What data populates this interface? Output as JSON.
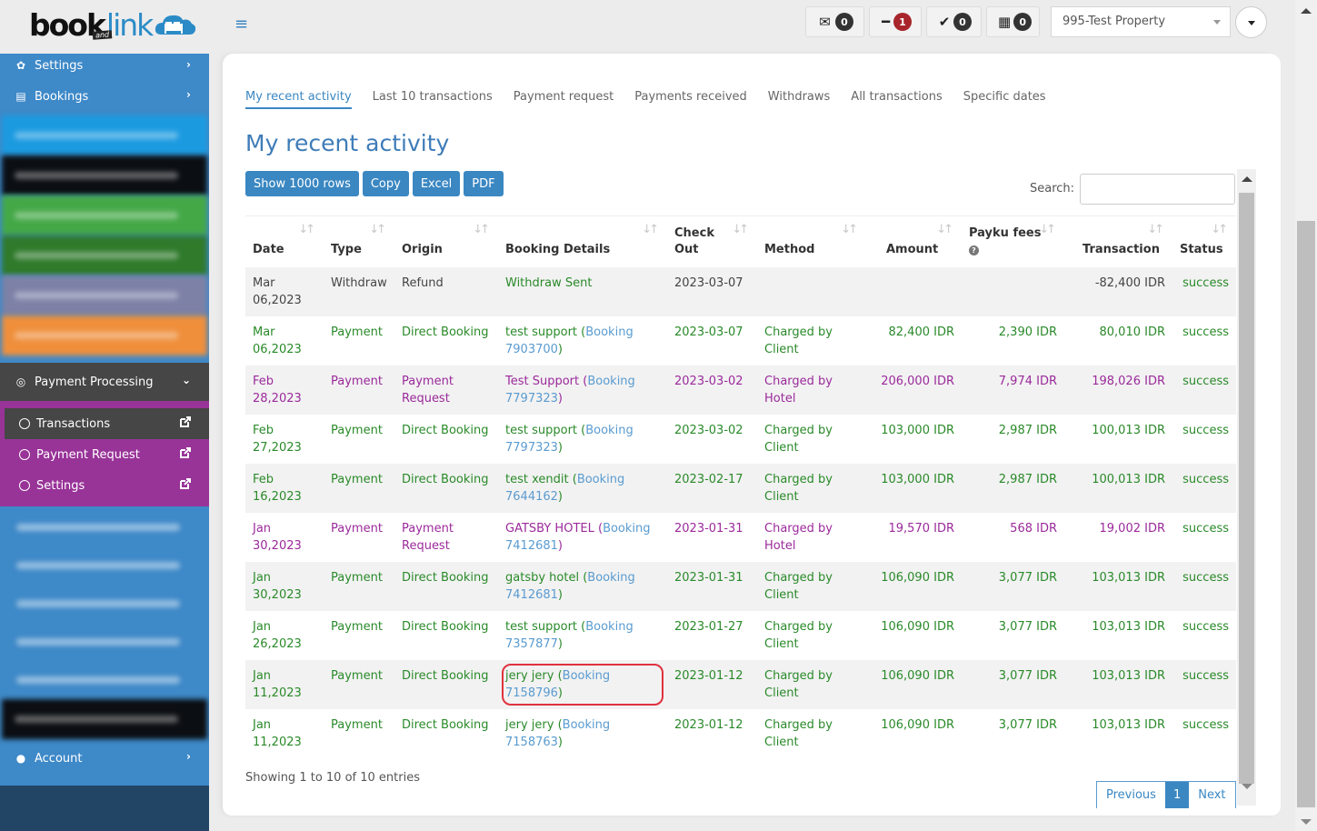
{
  "header": {
    "logo": {
      "book": "book",
      "and": "and",
      "link": "link"
    },
    "badges": [
      {
        "icon": "envelope-open-icon",
        "glyph": "✉",
        "count": "0",
        "color": "#333333"
      },
      {
        "icon": "minus-icon",
        "glyph": "━",
        "count": "1",
        "color": "#a8252b"
      },
      {
        "icon": "check-icon",
        "glyph": "✔",
        "count": "0",
        "color": "#333333"
      },
      {
        "icon": "calendar-icon",
        "glyph": "▦",
        "count": "0",
        "color": "#333333"
      }
    ],
    "property_select": "995-Test Property"
  },
  "sidebar": {
    "top_items": [
      {
        "label": "Settings",
        "icon": "gear-icon"
      },
      {
        "label": "Bookings",
        "icon": "bookings-icon"
      }
    ],
    "payment_processing": {
      "label": "Payment Processing",
      "icon": "target-icon",
      "children": [
        {
          "label": "Transactions",
          "active": true
        },
        {
          "label": "Payment Request",
          "active": false
        },
        {
          "label": "Settings",
          "active": false
        }
      ]
    },
    "account": {
      "label": "Account",
      "icon": "user-icon"
    }
  },
  "main": {
    "tabs": [
      {
        "label": "My recent activity",
        "active": true
      },
      {
        "label": "Last 10 transactions",
        "active": false
      },
      {
        "label": "Payment request",
        "active": false
      },
      {
        "label": "Payments received",
        "active": false
      },
      {
        "label": "Withdraws",
        "active": false
      },
      {
        "label": "All transactions",
        "active": false
      },
      {
        "label": "Specific dates",
        "active": false
      }
    ],
    "title": "My recent activity",
    "actions": [
      "Show 1000 rows",
      "Copy",
      "Excel",
      "PDF"
    ],
    "search_label": "Search:",
    "search_value": "",
    "colors": {
      "green": "#2a8a2a",
      "purple": "#9b2a9b",
      "link": "#5a9bd0",
      "accent": "#3a87c2"
    },
    "table": {
      "columns": [
        {
          "line1": "",
          "line2": "Date"
        },
        {
          "line1": "",
          "line2": "Type"
        },
        {
          "line1": "",
          "line2": "Origin"
        },
        {
          "line1": "",
          "line2": "Booking Details"
        },
        {
          "line1": "Check",
          "line2": "Out"
        },
        {
          "line1": "",
          "line2": "Method"
        },
        {
          "line1": "",
          "line2": "Amount"
        },
        {
          "line1": "Payku fees",
          "line2": "?"
        },
        {
          "line1": "",
          "line2": "Transaction"
        },
        {
          "line1": "",
          "line2": "Status"
        }
      ],
      "rows": [
        {
          "style": "withdraw",
          "date": "Mar 06,2023",
          "type": "Withdraw",
          "origin": "Refund",
          "guest": "Withdraw Sent",
          "booking": "",
          "checkout": "2023-03-07",
          "method": "",
          "amount": "",
          "fees": "",
          "transaction": "-82,400 IDR",
          "status": "success"
        },
        {
          "style": "green",
          "date": "Mar 06,2023",
          "type": "Payment",
          "origin": "Direct Booking",
          "guest": "test support",
          "booking": "7903700",
          "checkout": "2023-03-07",
          "method": "Charged by Client",
          "amount": "82,400 IDR",
          "fees": "2,390 IDR",
          "transaction": "80,010 IDR",
          "status": "success"
        },
        {
          "style": "purple",
          "date": "Feb 28,2023",
          "type": "Payment",
          "origin": "Payment Request",
          "guest": "Test Support",
          "booking": "7797323",
          "checkout": "2023-03-02",
          "method": "Charged by Hotel",
          "amount": "206,000 IDR",
          "fees": "7,974 IDR",
          "transaction": "198,026 IDR",
          "status": "success"
        },
        {
          "style": "green",
          "date": "Feb 27,2023",
          "type": "Payment",
          "origin": "Direct Booking",
          "guest": "test support",
          "booking": "7797323",
          "checkout": "2023-03-02",
          "method": "Charged by Client",
          "amount": "103,000 IDR",
          "fees": "2,987 IDR",
          "transaction": "100,013 IDR",
          "status": "success"
        },
        {
          "style": "green",
          "date": "Feb 16,2023",
          "type": "Payment",
          "origin": "Direct Booking",
          "guest": "test xendit",
          "booking": "7644162",
          "checkout": "2023-02-17",
          "method": "Charged by Client",
          "amount": "103,000 IDR",
          "fees": "2,987 IDR",
          "transaction": "100,013 IDR",
          "status": "success"
        },
        {
          "style": "purple",
          "date": "Jan 30,2023",
          "type": "Payment",
          "origin": "Payment Request",
          "guest": "GATSBY HOTEL",
          "booking": "7412681",
          "checkout": "2023-01-31",
          "method": "Charged by Hotel",
          "amount": "19,570 IDR",
          "fees": "568 IDR",
          "transaction": "19,002 IDR",
          "status": "success"
        },
        {
          "style": "green",
          "date": "Jan 30,2023",
          "type": "Payment",
          "origin": "Direct Booking",
          "guest": "gatsby hotel",
          "booking": "7412681",
          "checkout": "2023-01-31",
          "method": "Charged by Client",
          "amount": "106,090 IDR",
          "fees": "3,077 IDR",
          "transaction": "103,013 IDR",
          "status": "success"
        },
        {
          "style": "green",
          "date": "Jan 26,2023",
          "type": "Payment",
          "origin": "Direct Booking",
          "guest": "test support",
          "booking": "7357877",
          "checkout": "2023-01-27",
          "method": "Charged by Client",
          "amount": "106,090 IDR",
          "fees": "3,077 IDR",
          "transaction": "103,013 IDR",
          "status": "success"
        },
        {
          "style": "green",
          "date": "Jan 11,2023",
          "type": "Payment",
          "origin": "Direct Booking",
          "guest": "jery jery",
          "booking": "7158796",
          "checkout": "2023-01-12",
          "method": "Charged by Client",
          "amount": "106,090 IDR",
          "fees": "3,077 IDR",
          "transaction": "103,013 IDR",
          "status": "success",
          "highlighted": true
        },
        {
          "style": "green",
          "date": "Jan 11,2023",
          "type": "Payment",
          "origin": "Direct Booking",
          "guest": "jery jery",
          "booking": "7158763",
          "checkout": "2023-01-12",
          "method": "Charged by Client",
          "amount": "106,090 IDR",
          "fees": "3,077 IDR",
          "transaction": "103,013 IDR",
          "status": "success"
        }
      ],
      "booking_word": "Booking"
    },
    "info": "Showing 1 to 10 of 10 entries",
    "pagination": {
      "previous": "Previous",
      "current": "1",
      "next": "Next"
    }
  }
}
